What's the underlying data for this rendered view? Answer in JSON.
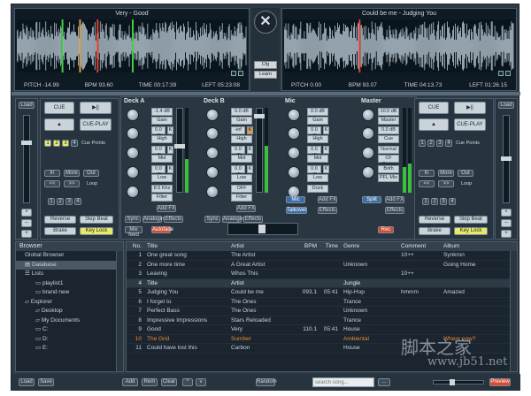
{
  "deckA": {
    "title": "Very - Good",
    "pitch": "PITCH  -14.99",
    "bpm": "BPM  93.60",
    "time": "TIME  00:17:39",
    "left": "LEFT  05:23:08"
  },
  "deckB": {
    "title": "Could be me - Judging You",
    "pitch": "PITCH  0.00",
    "bpm": "BPM  93.07",
    "time": "TIME  04:13.73",
    "left": "LEFT  01:26.15"
  },
  "center": {
    "cfg": "Cfg",
    "learn": "Learn"
  },
  "sideA": {
    "load": "Load",
    "cue": "CUE",
    "play": "▶||",
    "eject": "▲",
    "cueplay": "CUE-PLAY",
    "cuepoints": "Cue Points",
    "cue_nums": [
      "1",
      "2",
      "3",
      "4"
    ],
    "in": "In",
    "more": "More",
    "out": "Out",
    "loop": "Loop",
    "back": "<<",
    "fwd": ">>",
    "loop_nums": [
      "1",
      "2",
      "3",
      "4"
    ],
    "reverse": "Reverse",
    "skip": "Skip Beat",
    "brake": "Brake",
    "keylock": "Key Lock",
    "minus": "–",
    "plus": "+"
  },
  "sideB": {
    "load": "Load",
    "cue": "CUE",
    "play": "▶||",
    "eject": "▲",
    "cueplay": "CUE-PLAY",
    "cuepoints": "Cue Points",
    "cue_nums": [
      "1",
      "2",
      "3",
      "4"
    ],
    "in": "In",
    "more": "More",
    "out": "Out",
    "loop": "Loop",
    "back": "<<",
    "fwd": ">>",
    "loop_nums": [
      "1",
      "2",
      "3",
      "4"
    ],
    "reverse": "Reverse",
    "skip": "Skip Beat",
    "brake": "Brake",
    "keylock": "Key Lock",
    "minus": "–",
    "plus": "+"
  },
  "mixer": {
    "deckA": {
      "title": "Deck A",
      "gain_val": "-1.4 dB",
      "gain": "Gain",
      "high_val": "0.0 dB",
      "high": "High",
      "mid_val": "0.0 dB",
      "mid": "Mid",
      "low_val": "0.0 dB",
      "low": "Low",
      "kill": "K",
      "filter_val": "8.5 Khz",
      "filter": "Filter",
      "addfx": "Add FX",
      "sync": "Sync",
      "analogin": "Analogin",
      "effects": "Effects"
    },
    "deckB": {
      "title": "Deck B",
      "gain_val": "0.0 dB",
      "gain": "Gain",
      "high_val": "-inf",
      "high": "High",
      "mid_val": "0.0 dB",
      "mid": "Mid",
      "low_val": "0.0 dB",
      "low": "Low",
      "kill": "K",
      "filter_val": "OFF",
      "filter": "Filter",
      "addfx": "Add FX",
      "sync": "Sync",
      "analogin": "Analogin",
      "effects": "Effects"
    },
    "mic": {
      "title": "Mic",
      "gain_val": "0.0 dB",
      "gain": "Gain",
      "high_val": "0.0 dB",
      "high": "High",
      "mid_val": "0.0 dB",
      "mid": "Mid",
      "low_val": "0.0 dB",
      "low": "Low",
      "kill": "K",
      "duck": "Duck",
      "addfx": "Add FX",
      "talkover": "Talkover",
      "effects": "Effects"
    },
    "master": {
      "title": "Master",
      "gain_val": "10.0 dB",
      "gain": "Master",
      "cue_val": "0.0 dB",
      "cue": "Cue",
      "normal": "Normal",
      "cfcurve": "CF Curve",
      "bal": "Both",
      "spl": "PFL Mix",
      "addfx": "Add FX",
      "split": "Split",
      "effects": "Effects"
    },
    "minifeed": "Mix feed",
    "autofade": "Autofade",
    "rec": "Rec"
  },
  "browser": {
    "header": "Browser",
    "items": [
      "Global Browser",
      "Database",
      "Lists",
      "playlist1",
      "brand new",
      "Explorer",
      "Desktop",
      "My Documents",
      "C:",
      "D:",
      "E:"
    ]
  },
  "tracks": {
    "headers": {
      "no": "No.",
      "title": "Title",
      "artist": "Artist",
      "bpm": "BPM",
      "time": "Time",
      "genre": "Genre",
      "comment": "Comment",
      "album": "Album"
    },
    "rows": [
      {
        "no": "1",
        "title": "One great song",
        "artist": "The Artist",
        "bpm": "",
        "time": "",
        "genre": "",
        "comment": "10++",
        "album": "Synkron"
      },
      {
        "no": "2",
        "title": "One more time",
        "artist": "A Great Artist",
        "bpm": "",
        "time": "",
        "genre": "Unknown",
        "comment": "",
        "album": "Going Home"
      },
      {
        "no": "3",
        "title": "Leaving",
        "artist": "Whos This",
        "bpm": "",
        "time": "",
        "genre": "",
        "comment": "10++",
        "album": ""
      },
      {
        "no": "4",
        "title": "Title",
        "artist": "Artist",
        "bpm": "",
        "time": "",
        "genre": "Jungle",
        "comment": "",
        "album": ""
      },
      {
        "no": "5",
        "title": "Judging You",
        "artist": "Could be me",
        "bpm": "093.1",
        "time": "05:41",
        "genre": "Hip-Hop",
        "comment": "hmmm",
        "album": "Amazed"
      },
      {
        "no": "6",
        "title": "I forget to",
        "artist": "The Ones",
        "bpm": "",
        "time": "",
        "genre": "Trance",
        "comment": "",
        "album": ""
      },
      {
        "no": "7",
        "title": "Perfect Bass",
        "artist": "The Ones",
        "bpm": "",
        "time": "",
        "genre": "Unknown",
        "comment": "",
        "album": ""
      },
      {
        "no": "8",
        "title": "Impressive Impressions",
        "artist": "Stars Reloaded",
        "bpm": "",
        "time": "",
        "genre": "Trance",
        "comment": "",
        "album": ""
      },
      {
        "no": "9",
        "title": "Good",
        "artist": "Very",
        "bpm": "110.1",
        "time": "05:41",
        "genre": "House",
        "comment": "",
        "album": ""
      },
      {
        "no": "10",
        "title": "The Grid",
        "artist": "Sumber",
        "bpm": "",
        "time": "",
        "genre": "Ambiental",
        "comment": "",
        "album": "Where now?"
      },
      {
        "no": "11",
        "title": "Could have lost this",
        "artist": "Carbon",
        "bpm": "",
        "time": "",
        "genre": "House",
        "comment": "",
        "album": ""
      }
    ]
  },
  "bottom": {
    "load": "Load",
    "save": "Save",
    "add": "Add",
    "rem": "Rem",
    "clear": "Clear",
    "up": "^",
    "down": "v",
    "random": "Random",
    "search_placeholder": "search song...",
    "dots": "...",
    "preview": "Preview"
  },
  "watermark": {
    "cn": "脚本之家",
    "url": "www.jb51.net"
  }
}
